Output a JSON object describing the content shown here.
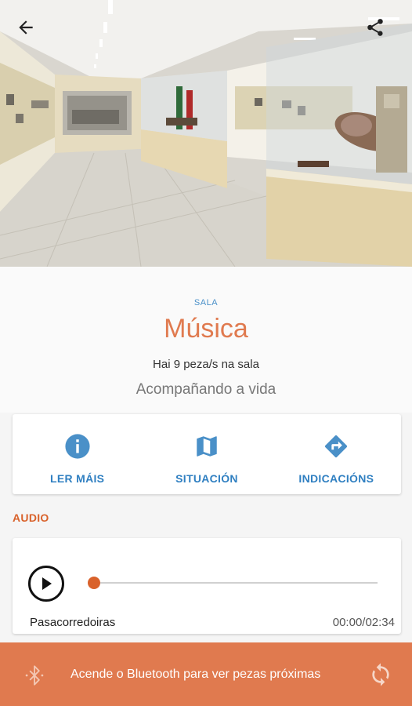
{
  "room": {
    "label": "SALA",
    "title": "Música",
    "count": "Hai 9 peza/s na sala",
    "subtitle": "Acompañando a vida"
  },
  "header": {
    "back_icon": "arrow-left-icon",
    "share_icon": "share-icon"
  },
  "actions": [
    {
      "label": "LER MÁIS",
      "icon": "info-icon"
    },
    {
      "label": "SITUACIÓN",
      "icon": "map-icon"
    },
    {
      "label": "INDICACIÓNS",
      "icon": "directions-icon"
    }
  ],
  "audio": {
    "section_label": "AUDIO",
    "track_name": "Pasacorredoiras",
    "time": "00:00/02:34",
    "progress": 0
  },
  "bottom_bar": {
    "text": "Acende o Bluetooth para ver pezas próximas",
    "bluetooth_icon": "bluetooth-icon",
    "refresh_icon": "refresh-icon"
  },
  "colors": {
    "accent": "#e07a4f",
    "audio_label": "#d9622b",
    "link_blue": "#2f7fc1",
    "label_blue": "#4a90c8"
  }
}
